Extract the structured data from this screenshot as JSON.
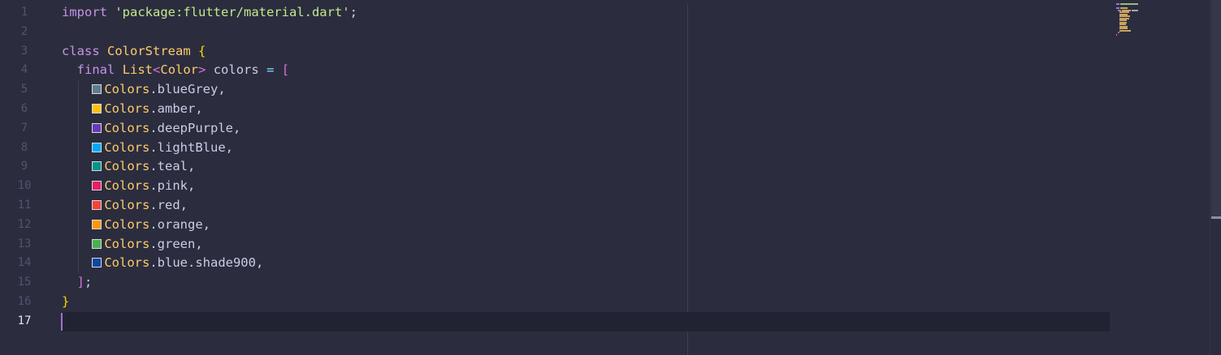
{
  "editor": {
    "active_line_number": "17",
    "line_numbers": [
      "1",
      "2",
      "3",
      "4",
      "5",
      "6",
      "7",
      "8",
      "9",
      "10",
      "11",
      "12",
      "13",
      "14",
      "15",
      "16",
      "17"
    ],
    "lines": {
      "l1": {
        "kw_import": "import",
        "string": "'package:flutter/material.dart'",
        "semi": ";"
      },
      "l3": {
        "kw_class": "class",
        "class_name": "ColorStream",
        "brace": "{"
      },
      "l4": {
        "kw_final": "final",
        "type_list": "List",
        "lt": "<",
        "type_color": "Color",
        "gt": ">",
        "var_name": "colors",
        "eq": "=",
        "bracket_open": "["
      },
      "colors": [
        {
          "class": "Colors",
          "member": ".blueGrey,",
          "swatch": "#607d8b"
        },
        {
          "class": "Colors",
          "member": ".amber,",
          "swatch": "#ffc107"
        },
        {
          "class": "Colors",
          "member": ".deepPurple,",
          "swatch": "#673ab7"
        },
        {
          "class": "Colors",
          "member": ".lightBlue,",
          "swatch": "#03a9f4"
        },
        {
          "class": "Colors",
          "member": ".teal,",
          "swatch": "#009688"
        },
        {
          "class": "Colors",
          "member": ".pink,",
          "swatch": "#e91e63"
        },
        {
          "class": "Colors",
          "member": ".red,",
          "swatch": "#f44336"
        },
        {
          "class": "Colors",
          "member": ".orange,",
          "swatch": "#ff9800"
        },
        {
          "class": "Colors",
          "member": ".green,",
          "swatch": "#4caf50"
        },
        {
          "class": "Colors",
          "member": ".blue.shade900,",
          "swatch": "#0d47a1"
        }
      ],
      "l15": {
        "bracket_close": "]",
        "semi": ";"
      },
      "l16": {
        "brace_close": "}"
      }
    }
  },
  "theme": {
    "background": "#2b2d3e",
    "current_line": "#212332",
    "cursor": "#9c6fd1",
    "keyword": "#c792ea",
    "string": "#c3e88d",
    "class": "#ffcb6b"
  }
}
